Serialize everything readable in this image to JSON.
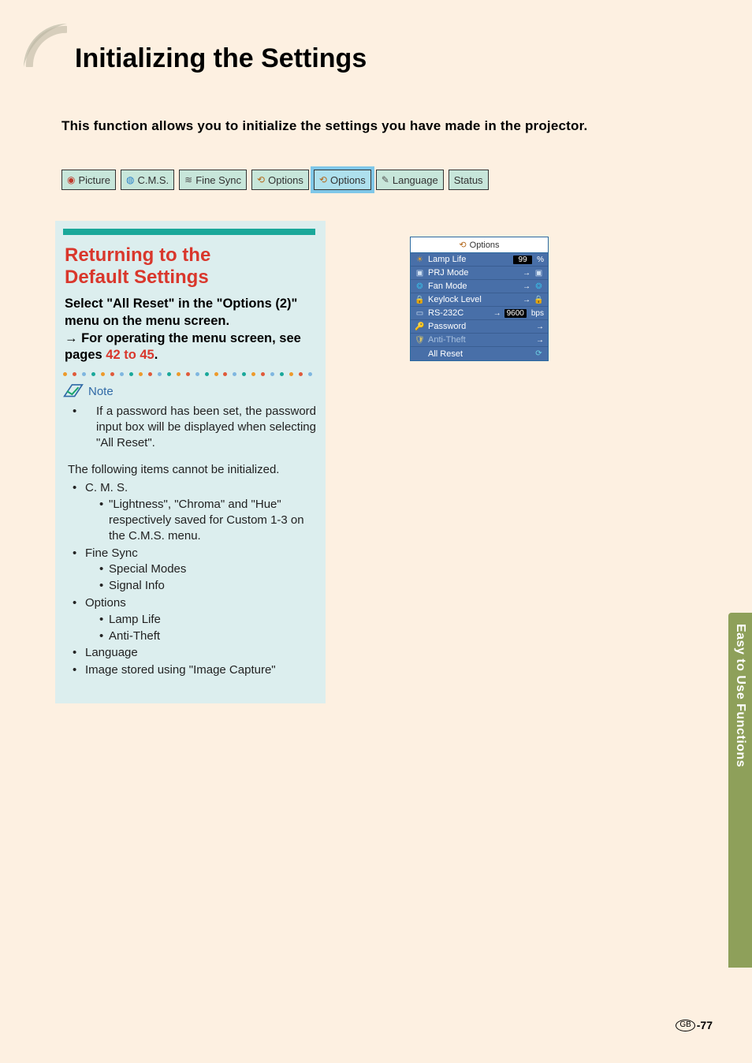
{
  "page": {
    "title": "Initializing the Settings",
    "intro": "This function allows you to initialize the settings you have made in the projector.",
    "side_tab": "Easy to Use Functions",
    "page_lang": "GB",
    "page_num": "-77"
  },
  "tabs": [
    {
      "label": "Picture"
    },
    {
      "label": "C.M.S."
    },
    {
      "label": "Fine Sync"
    },
    {
      "label": "Options"
    },
    {
      "label": "Options"
    },
    {
      "label": "Language"
    },
    {
      "label": "Status"
    }
  ],
  "section": {
    "heading_l1": "Returning to the",
    "heading_l2": "Default Settings",
    "instr_l1": "Select \"All Reset\" in the \"Options (2)\"",
    "instr_l2": "menu on the menu screen.",
    "instr_l3a": "For operating the menu screen, see",
    "instr_l4a": "pages ",
    "instr_link": "42 to 45",
    "instr_period": "."
  },
  "note": {
    "label": "Note",
    "first_bullet": "If a password has been set, the password input box will be displayed when selecting \"All Reset\".",
    "cannot_init": "The following items cannot be initialized.",
    "items": {
      "cms": "C. M. S.",
      "cms_sub": "\"Lightness\", \"Chroma\" and \"Hue\" respectively  saved for Custom 1-3 on the C.M.S. menu.",
      "finesync": "Fine Sync",
      "fs_sub1": "Special Modes",
      "fs_sub2": "Signal Info",
      "options": "Options",
      "op_sub1": "Lamp Life",
      "op_sub2": "Anti-Theft",
      "language": "Language",
      "image_capture": "Image stored using \"Image Capture\""
    }
  },
  "menu": {
    "title": "Options",
    "rows": {
      "lamp": {
        "icon": "☀",
        "iconColor": "#e6a531",
        "label": "Lamp Life",
        "value": "99",
        "unit": "%"
      },
      "prj": {
        "icon": "▣",
        "iconColor": "#cfe0f2",
        "label": "PRJ Mode",
        "arrow": "→",
        "tail": "▣"
      },
      "fan": {
        "icon": "❂",
        "iconColor": "#3bb4e0",
        "label": "Fan Mode",
        "arrow": "→",
        "tail": "❂"
      },
      "keylock": {
        "icon": "🔒",
        "iconColor": "#d6c36a",
        "label": "Keylock Level",
        "arrow": "→",
        "tail": "🔒"
      },
      "rs232": {
        "icon": "▭",
        "iconColor": "#cfe0f2",
        "label": "RS-232C",
        "arrow": "→",
        "value": "9600",
        "unit": "bps"
      },
      "password": {
        "icon": "🔑",
        "iconColor": "#e05a3a",
        "label": "Password",
        "arrow": "→"
      },
      "anti": {
        "icon": "🛡",
        "iconColor": "#d6c36a",
        "label": "Anti-Theft",
        "arrow": "→"
      },
      "reset": {
        "label": "All Reset",
        "tail": "⟳"
      }
    }
  }
}
